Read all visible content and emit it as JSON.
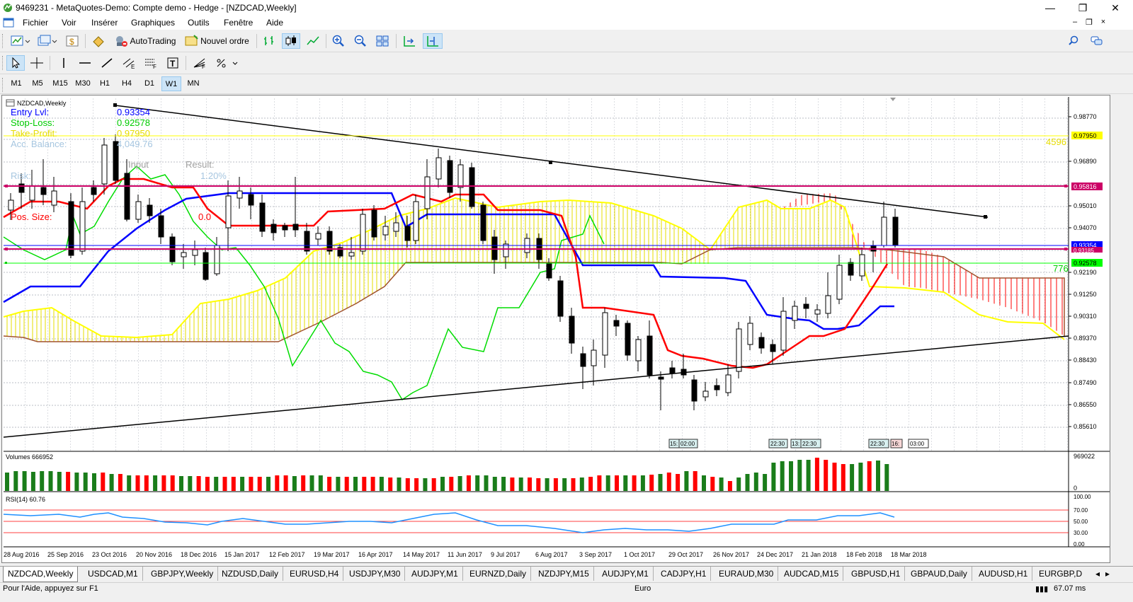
{
  "window": {
    "title": "9469231 - MetaQuotes-Demo: Compte demo - Hedge - [NZDCAD,Weekly]",
    "minimize_glyph": "—",
    "restore_glyph": "❐",
    "close_glyph": "✕"
  },
  "menu": {
    "items": [
      "Fichier",
      "Voir",
      "Insérer",
      "Graphiques",
      "Outils",
      "Fenêtre",
      "Aide"
    ],
    "mdi_minimize": "–",
    "mdi_restore": "❐",
    "mdi_close": "×"
  },
  "toolbar": {
    "autotrading_label": "AutoTrading",
    "new_order_label": "Nouvel ordre"
  },
  "timeframes": [
    "M1",
    "M5",
    "M15",
    "M30",
    "H1",
    "H4",
    "D1",
    "W1",
    "MN"
  ],
  "active_timeframe": "W1",
  "chart": {
    "symbol_label": "NZDCAD,Weekly",
    "price_labels": [
      "0.98770",
      "0.97950",
      "0.96890",
      "0.95816",
      "0.95010",
      "0.94070",
      "0.93354",
      "0.93185",
      "0.92578",
      "0.92190",
      "0.91250",
      "0.90310",
      "0.89370",
      "0.88430",
      "0.87490",
      "0.86550",
      "0.85610"
    ],
    "date_labels": [
      "28 Aug 2016",
      "25 Sep 2016",
      "23 Oct 2016",
      "20 Nov 2016",
      "18 Dec 2016",
      "15 Jan 2017",
      "12 Feb 2017",
      "19 Mar 2017",
      "16 Apr 2017",
      "14 May 2017",
      "11 Jun 2017",
      "9 Jul 2017",
      "6 Aug 2017",
      "3 Sep 2017",
      "1 Oct 2017",
      "29 Oct 2017",
      "26 Nov 2017",
      "24 Dec 2017",
      "21 Jan 2018",
      "18 Feb 2018",
      "18 Mar 2018"
    ],
    "tp_distance": "4596",
    "sl_distance": "776",
    "event_labels": [
      "15:",
      "02:00",
      "22:30",
      "13:",
      "22:30",
      "22:30",
      "16:",
      "03:00"
    ]
  },
  "ea_panel": {
    "entry_label": "Entry Lvl:",
    "entry_value": "0.93354",
    "stop_label": "Stop-Loss:",
    "stop_value": "0.92578",
    "tp_label": "Take-Profit:",
    "tp_value": "0.97950",
    "balance_label": "Acc. Balance:",
    "balance_value": "4,049.76",
    "input_header": "Input",
    "result_header": "Result:",
    "risk_label": "Risk:",
    "risk_result": "1.20%",
    "pos_size_label": "Pos. Size:",
    "pos_size_value": "0.0"
  },
  "volumes": {
    "label": "Volumes 666952",
    "scale_top": "969022",
    "scale_bottom": "0"
  },
  "rsi": {
    "label": "RSI(14) 60.76",
    "levels": [
      "100.00",
      "70.00",
      "50.00",
      "30.00",
      "0.00"
    ]
  },
  "tabs": [
    "NZDCAD,Weekly",
    "USDCAD,M1",
    "GBPJPY,Weekly",
    "NZDUSD,Daily",
    "EURUSD,H4",
    "USDJPY,M30",
    "AUDJPY,M1",
    "EURNZD,Daily",
    "NZDJPY,M15",
    "AUDJPY,M1",
    "CADJPY,H1",
    "EURAUD,M30",
    "AUDCAD,M15",
    "GBPUSD,H1",
    "GBPAUD,Daily",
    "AUDUSD,H1",
    "EURGBP,D"
  ],
  "status": {
    "help": "Pour l'Aide, appuyez sur F1",
    "profile": "Euro",
    "ping": "67.07 ms"
  },
  "colors": {
    "bull_volume": "#1a7d1a",
    "bear_volume": "#ff0000",
    "tenkan": "#ff0000",
    "kijun": "#0000ff",
    "chikou": "#00dd00",
    "senkou_a": "#ffff00",
    "entry_line": "#0000ff",
    "tp_line": "#ffff00",
    "sl_line": "#00ff00",
    "rsi_line": "#1e90ff"
  }
}
